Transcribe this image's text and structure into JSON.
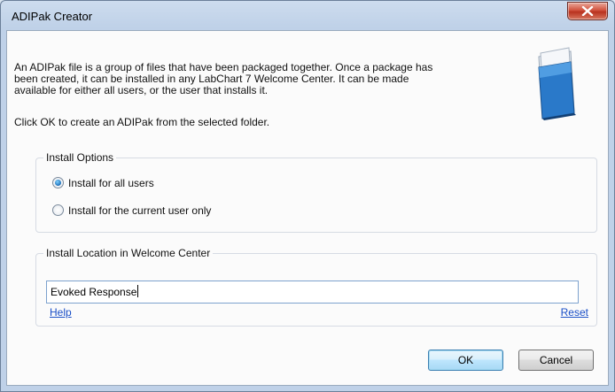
{
  "window": {
    "title": "ADIPak Creator",
    "close_icon": "close-icon"
  },
  "description": {
    "line1": "An ADIPak file is a group of files that have been packaged together. Once a package has",
    "line2": "been created, it can be installed in any LabChart 7 Welcome Center. It can be made",
    "line3": "available for either all users, or the user that installs it.",
    "instruction": "Click OK to create an ADIPak from the selected folder."
  },
  "install_options": {
    "label": "Install Options",
    "options": [
      {
        "label": "Install for all users",
        "checked": true
      },
      {
        "label": "Install for the current user only",
        "checked": false
      }
    ]
  },
  "install_location": {
    "label": "Install Location in Welcome Center",
    "value": "Evoked Response",
    "help_link": "Help",
    "reset_link": "Reset"
  },
  "buttons": {
    "ok": "OK",
    "cancel": "Cancel"
  },
  "colors": {
    "link": "#1a4fc7",
    "close_button": "#c8432e",
    "selected_radio": "#1d6fb8"
  }
}
